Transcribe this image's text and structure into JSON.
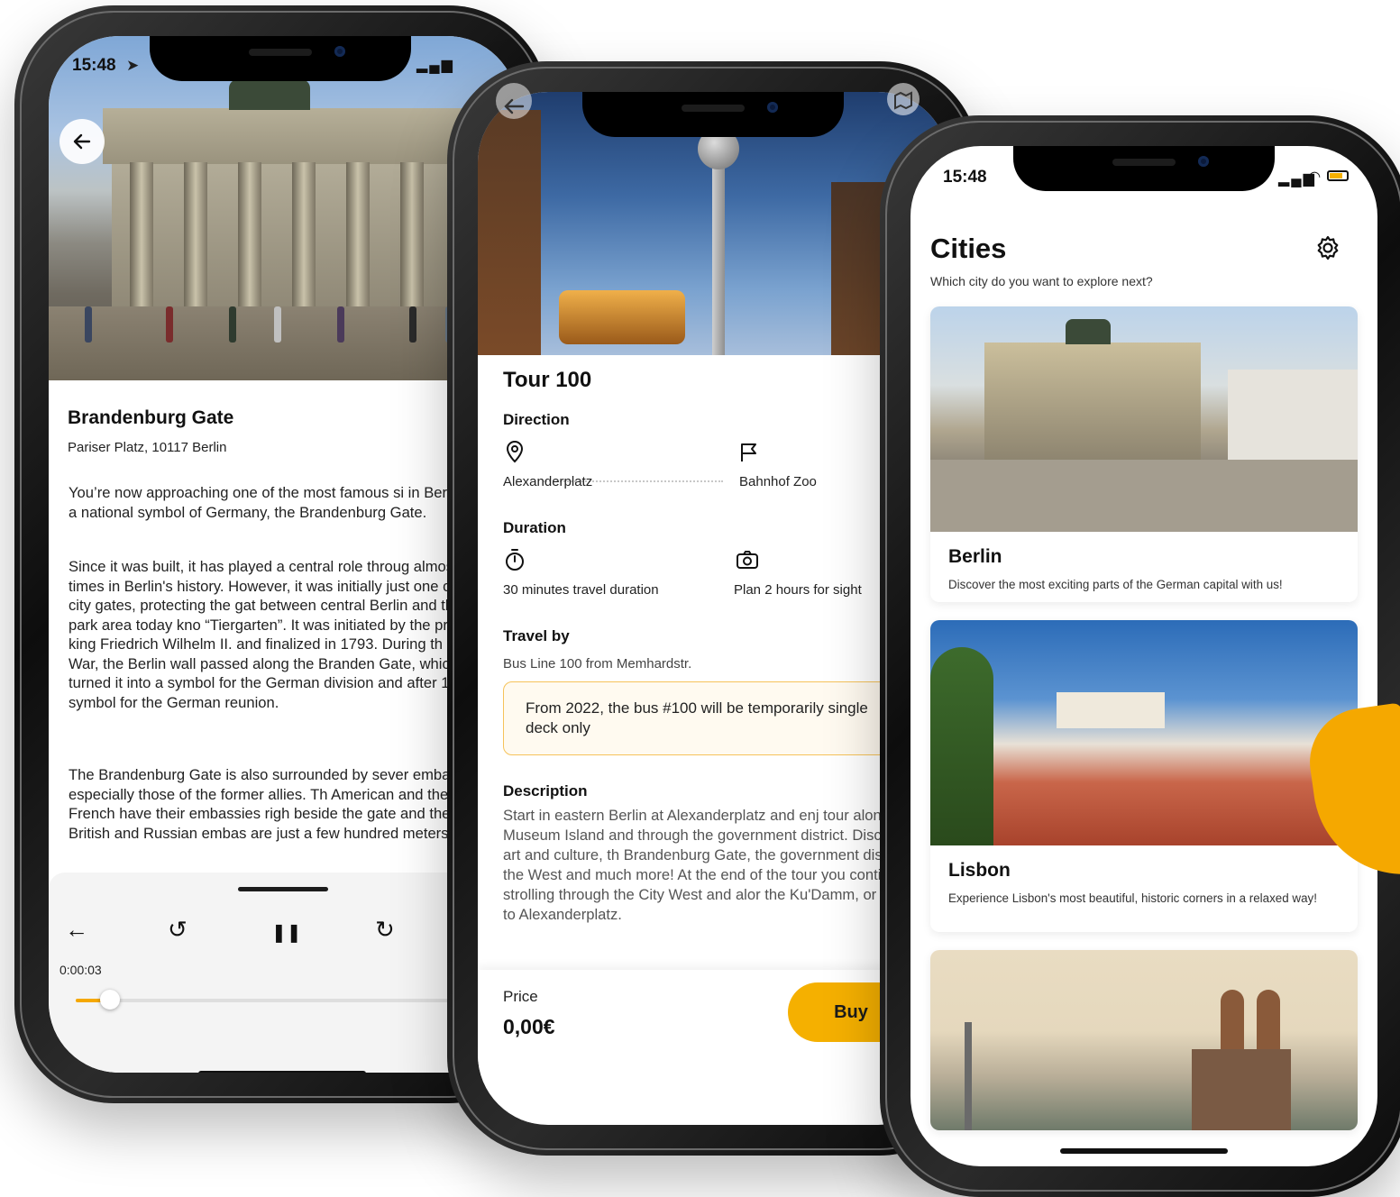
{
  "phone1": {
    "status_time": "15:48",
    "title": "Brandenburg Gate",
    "address": "Pariser Platz, 10117 Berlin",
    "paragraphs": [
      "You’re now approaching one of the most famous si in Berlin and a national symbol of Germany, the Brandenburg Gate.",
      "Since it was built, it has played a central role throug almost all times in Berlin's history. However, it was initially just one of 18 city gates, protecting the gat between central Berlin and the park area today kno “Tiergarten”. It was initiated by the prussian king Friedrich Wilhelm II. and finalized in 1793. During th Cold War, the Berlin wall passed along the Branden Gate, which turned it into a symbol for the German division and after 1989, a symbol for the German reunion.",
      "The Brandenburg Gate is also surrounded by sever embassies, especially those of the former allies. Th American and the French have their embassies righ beside the gate and the British and Russian embas are just a few hundred meters away."
    ],
    "player": {
      "elapsed": "0:00:03",
      "progress": 0.07,
      "back_glyph": "←",
      "rewind_glyph": "↺",
      "pause_glyph": "❚❚",
      "forward_glyph": "↻"
    }
  },
  "phone2": {
    "title": "Tour 100",
    "direction_heading": "Direction",
    "from": "Alexanderplatz",
    "to": "Bahnhof Zoo",
    "duration_heading": "Duration",
    "travel_duration": "30 minutes travel duration",
    "sight_duration": "Plan 2 hours for sight",
    "travel_heading": "Travel by",
    "travel_by": "Bus Line 100 from Memhardstr.",
    "notice": "From 2022, the bus #100 will be temporarily single deck only",
    "description_heading": "Description",
    "description": "Start in eastern Berlin at Alexanderplatz and enj tour along the Museum Island and through the government district. Discover art and culture, th Brandenburg Gate, the government district, the West and much more! At the end of the tour you continue strolling through the City West and alor the Ku'Damm, or return to Alexanderplatz.",
    "price_label": "Price",
    "price_value": "0,00€",
    "buy_label": "Buy"
  },
  "phone3": {
    "status_time": "15:48",
    "title": "Cities",
    "subtitle": "Which city do you want to explore next?",
    "cities": [
      {
        "name": "Berlin",
        "description": "Discover the most exciting parts of the German capital with us!"
      },
      {
        "name": "Lisbon",
        "description": "Experience Lisbon's most beautiful, historic corners in a relaxed way!"
      }
    ]
  },
  "colors": {
    "accent": "#f5b000",
    "notice_border": "#f6c35a",
    "notice_bg": "#fffaf0"
  },
  "icons": [
    "location-arrow-icon",
    "back-arrow-icon",
    "pin-icon",
    "flag-icon",
    "stopwatch-icon",
    "camera-icon",
    "gear-icon",
    "map-icon",
    "signal-icon",
    "wifi-icon",
    "battery-icon"
  ]
}
